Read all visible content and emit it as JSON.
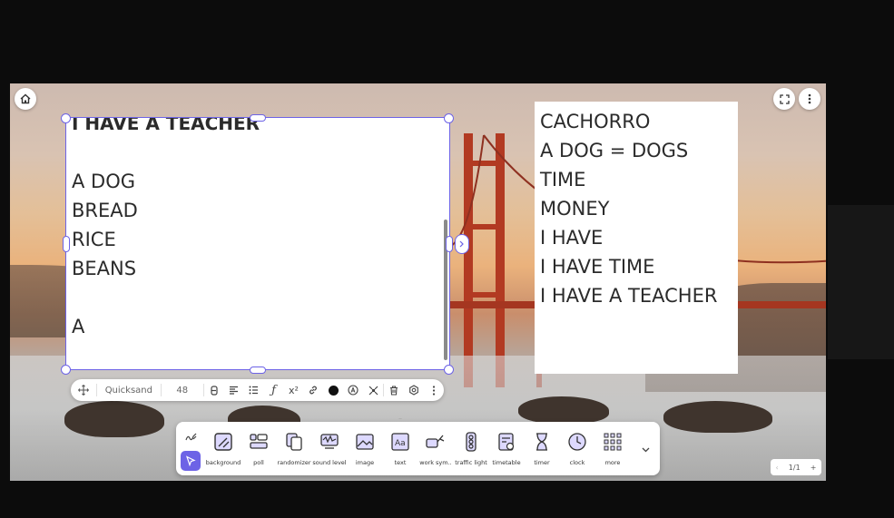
{
  "board": {
    "left_note": {
      "lines": [
        "I HAVE A TEACHER",
        "",
        "A DOG",
        "BREAD",
        "RICE",
        "BEANS",
        "",
        "A"
      ]
    },
    "right_note": {
      "lines": [
        "CACHORRO",
        "A DOG = DOGS",
        "TIME",
        "MONEY",
        "I HAVE",
        "I HAVE TIME",
        "I HAVE A TEACHER"
      ]
    },
    "home_icon": "home-icon",
    "fullscreen_icon": "fullscreen-icon",
    "menu_icon": "more-vertical-icon"
  },
  "text_toolbar": {
    "font": "Quicksand",
    "size": "48",
    "color": "#111111"
  },
  "dock": {
    "tools": [
      {
        "icon": "background-icon",
        "label": "background"
      },
      {
        "icon": "poll-icon",
        "label": "poll"
      },
      {
        "icon": "randomizer-icon",
        "label": "randomizer"
      },
      {
        "icon": "sound-level-icon",
        "label": "sound level"
      },
      {
        "icon": "image-icon",
        "label": "image"
      },
      {
        "icon": "text-icon",
        "label": "text"
      },
      {
        "icon": "work-symbols-icon",
        "label": "work sym.."
      },
      {
        "icon": "traffic-light-icon",
        "label": "traffic light"
      },
      {
        "icon": "timetable-icon",
        "label": "timetable"
      },
      {
        "icon": "timer-icon",
        "label": "timer"
      },
      {
        "icon": "clock-icon",
        "label": "clock"
      },
      {
        "icon": "more-grid-icon",
        "label": "more"
      }
    ],
    "accent": "#6d63e6"
  },
  "pager": {
    "text": "1/1",
    "add": "+"
  }
}
